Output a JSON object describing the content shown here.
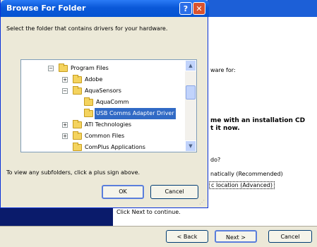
{
  "background_wizard": {
    "line_hardware_for": "ware for:",
    "line_cd_1": "me with an installation CD",
    "line_cd_2": "t it now.",
    "line_do": "do?",
    "option_auto": "natically (Recommended)",
    "option_specific": "c location (Advanced)",
    "continue_text": "Click Next to continue.",
    "back_button": "< Back",
    "next_button": "Next >",
    "cancel_button": "Cancel"
  },
  "dialog": {
    "title": "Browse For Folder",
    "help_button": "?",
    "close_button": "✕",
    "instruction": "Select the folder that contains drivers for your hardware.",
    "tree": [
      {
        "label": "Program Files",
        "expander": "−"
      },
      {
        "label": "Adobe",
        "expander": "+"
      },
      {
        "label": "AquaSensors",
        "expander": "−"
      },
      {
        "label": "AquaComm",
        "expander": ""
      },
      {
        "label": "USB Comms Adapter Driver",
        "expander": "",
        "selected": true
      },
      {
        "label": "ATI Technologies",
        "expander": "+"
      },
      {
        "label": "Common Files",
        "expander": "+"
      },
      {
        "label": "ComPlus Applications",
        "expander": ""
      }
    ],
    "hint": "To view any subfolders, click a plus sign above.",
    "ok_button": "OK",
    "cancel_button": "Cancel"
  },
  "icons": {
    "scroll_up": "▲",
    "scroll_down": "▼",
    "resize_grip": "⋰"
  }
}
